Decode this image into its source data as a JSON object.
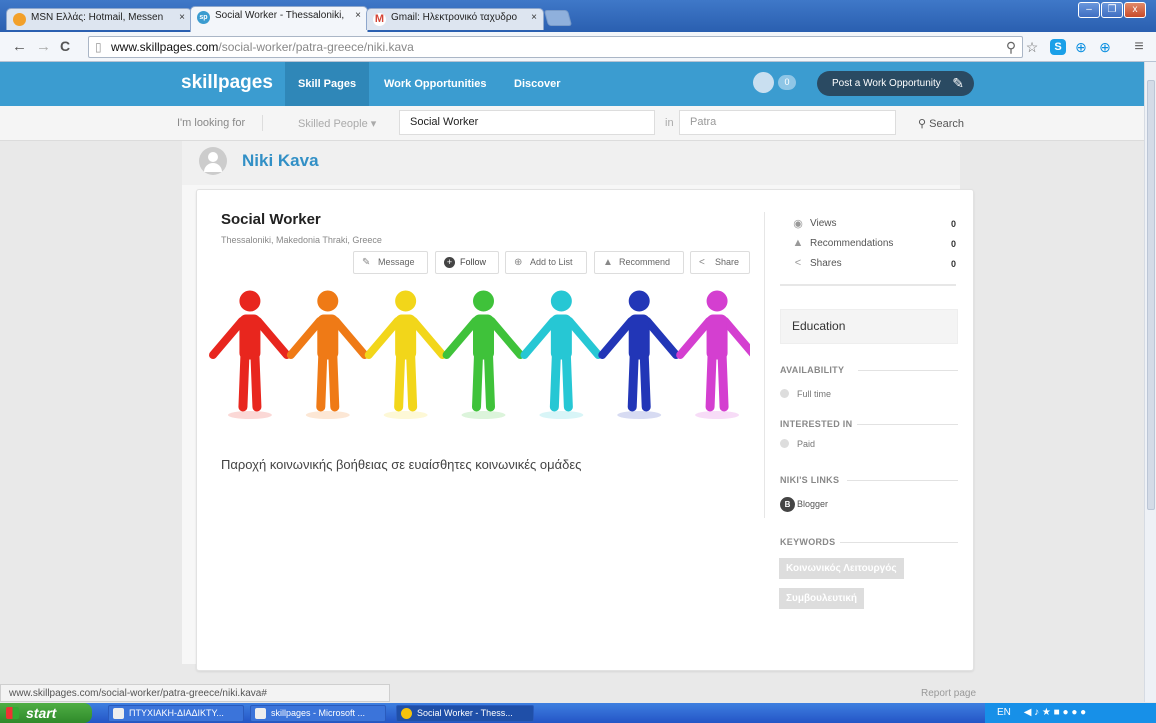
{
  "browser": {
    "tabs": [
      {
        "label": "MSN Ελλάς: Hotmail, Messen",
        "icon": "msn-icon",
        "color": "#f2a02a"
      },
      {
        "label": "Social Worker - Thessaloniki,",
        "icon": "sp",
        "color": "#3b9cd0"
      },
      {
        "label": "Gmail: Ηλεκτρονικό ταχυδρο",
        "icon": "M",
        "color": "#d44638"
      }
    ],
    "close_glyph": "×",
    "url_host": "www.skillpages.com",
    "url_path": "/social-worker/patra-greece/niki.kava"
  },
  "header": {
    "logo": "skillpages",
    "nav": [
      "Skill Pages",
      "Work Opportunities",
      "Discover"
    ],
    "notification_count": "0",
    "post_button": "Post a Work Opportunity"
  },
  "search": {
    "looking_for": "I'm looking for",
    "category": "Skilled People",
    "query": "Social Worker",
    "in_label": "in",
    "location": "Patra",
    "button": "Search"
  },
  "profile": {
    "name": "Niki Kava",
    "title": "Social Worker",
    "location": "Thessaloniki, Makedonia Thraki, Greece",
    "actions": [
      "Message",
      "Follow",
      "Add to List",
      "Recommend",
      "Share"
    ],
    "description": "Παροχή κοινωνικής βοήθειας σε ευαίσθητες κοινωνικές ομάδες"
  },
  "figure_colors": [
    "#e8261e",
    "#ef7a16",
    "#f2d61a",
    "#3fc23a",
    "#26c7d4",
    "#2236b7",
    "#d43fd0"
  ],
  "stats": [
    {
      "label": "Views",
      "value": "0",
      "icon": "eye-icon"
    },
    {
      "label": "Recommendations",
      "value": "0",
      "icon": "thumbs-up-icon"
    },
    {
      "label": "Shares",
      "value": "0",
      "icon": "share-icon"
    }
  ],
  "sidebar": {
    "education": "Education",
    "availability_heading": "AVAILABILITY",
    "availability_value": "Full time",
    "interested_heading": "INTERESTED IN",
    "interested_value": "Paid",
    "links_heading": "NIKI'S LINKS",
    "link": "Blogger",
    "keywords_heading": "KEYWORDS",
    "keywords": [
      "Κοινωνικός Λειτουργός",
      "Συμβουλευτική"
    ]
  },
  "status_url": "www.skillpages.com/social-worker/patra-greece/niki.kava#",
  "report_page": "Report page",
  "taskbar": {
    "start": "start",
    "tasks": [
      "ΠΤΥΧΙΑΚΗ-ΔΙΑΔΙΚΤΥ...",
      "skillpages - Microsoft ...",
      "Social Worker - Thess..."
    ],
    "language": "EN"
  }
}
